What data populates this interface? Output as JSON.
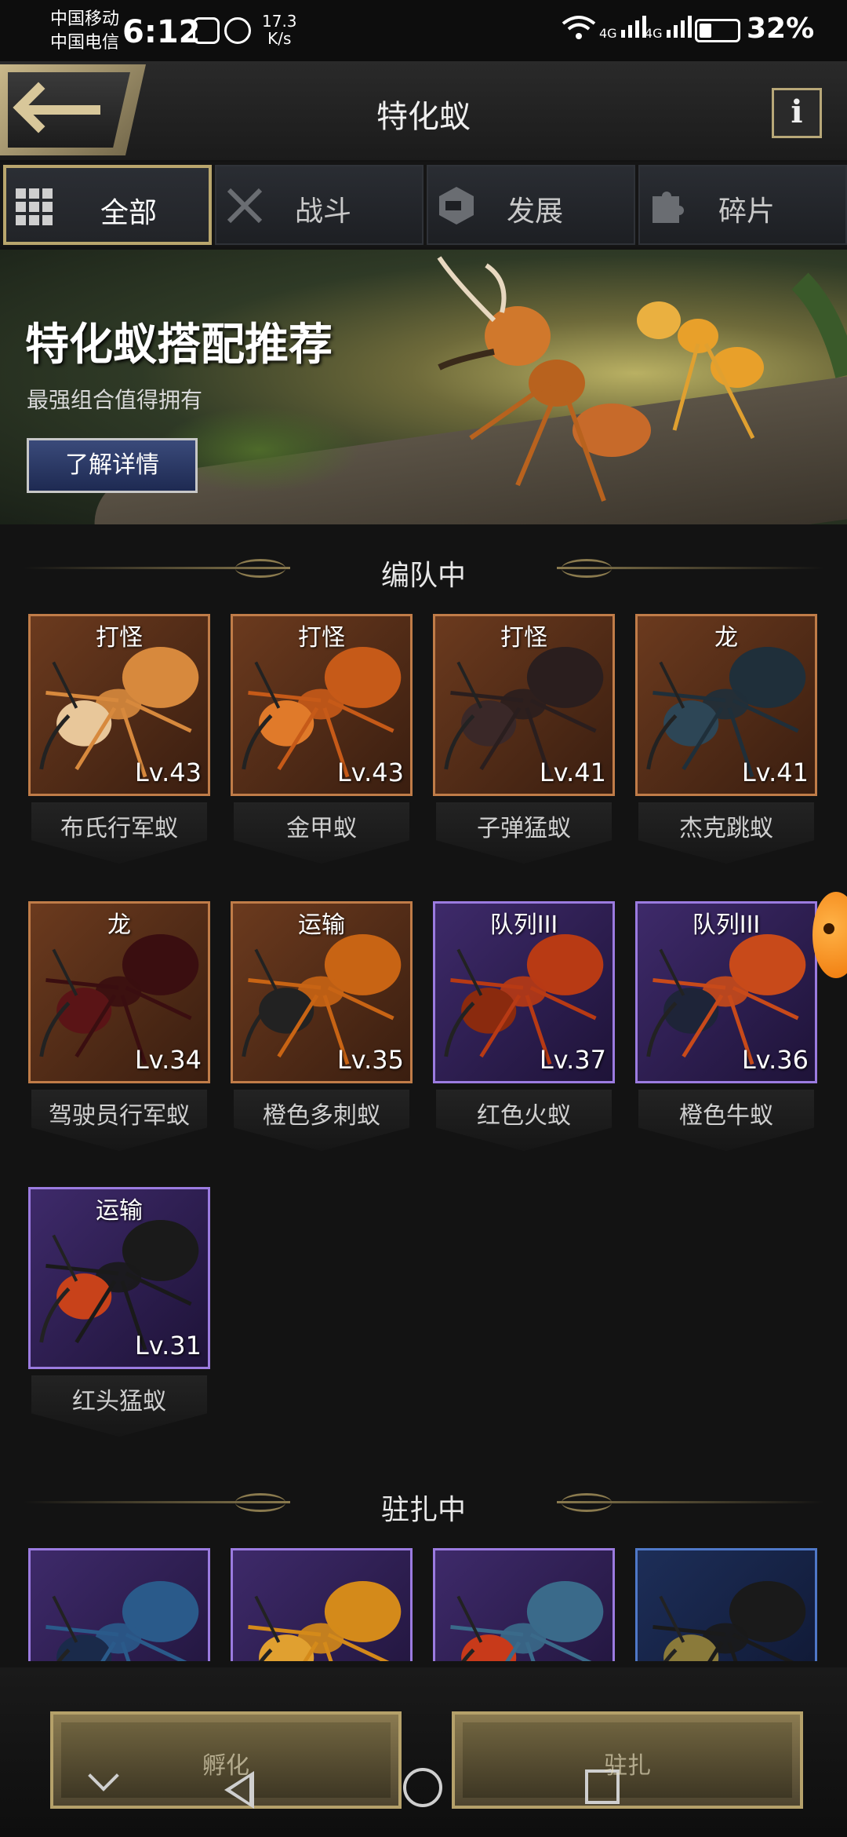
{
  "status_bar": {
    "carrier_1": "中国移动",
    "carrier_2": "中国电信",
    "time": "6:12",
    "net_speed_value": "17.3",
    "net_speed_unit": "K/s",
    "signal_1": "4G",
    "signal_2": "4G",
    "battery": "32%",
    "battery_level": 0.32
  },
  "header": {
    "title": "特化蚁",
    "info_label": "i"
  },
  "tabs": [
    {
      "label": "全部",
      "icon": "grid-icon",
      "active": true
    },
    {
      "label": "战斗",
      "icon": "crossed-swords-icon",
      "active": false
    },
    {
      "label": "发展",
      "icon": "hexagon-icon",
      "active": false
    },
    {
      "label": "碎片",
      "icon": "puzzle-icon",
      "active": false
    }
  ],
  "banner": {
    "title": "特化蚁搭配推荐",
    "subtitle": "最强组合值得拥有",
    "button": "了解详情"
  },
  "sections": {
    "in_team": "编队中",
    "garrisoned": "驻扎中"
  },
  "team_ants": [
    {
      "tag": "打怪",
      "level": "Lv.43",
      "name": "布氏行军蚁",
      "rarity": "orange",
      "body_color": "#d7893d",
      "head_color": "#e8c79a"
    },
    {
      "tag": "打怪",
      "level": "Lv.43",
      "name": "金甲蚁",
      "rarity": "orange",
      "body_color": "#c65a18",
      "head_color": "#e07a2a"
    },
    {
      "tag": "打怪",
      "level": "Lv.41",
      "name": "子弹猛蚁",
      "rarity": "orange",
      "body_color": "#2a1e1e",
      "head_color": "#3a2828"
    },
    {
      "tag": "龙",
      "level": "Lv.41",
      "name": "杰克跳蚁",
      "rarity": "orange",
      "body_color": "#1f2f3a",
      "head_color": "#2d4656"
    },
    {
      "tag": "龙",
      "level": "Lv.34",
      "name": "驾驶员行军蚁",
      "rarity": "orange",
      "body_color": "#3a0e10",
      "head_color": "#5a1416"
    },
    {
      "tag": "运输",
      "level": "Lv.35",
      "name": "橙色多刺蚁",
      "rarity": "orange",
      "body_color": "#c86414",
      "head_color": "#222222"
    },
    {
      "tag": "队列III",
      "level": "Lv.37",
      "name": "红色火蚁",
      "rarity": "purple",
      "body_color": "#b83a14",
      "head_color": "#8a2a0e"
    },
    {
      "tag": "队列III",
      "level": "Lv.36",
      "name": "橙色牛蚁",
      "rarity": "purple",
      "body_color": "#c84a1a",
      "head_color": "#1e2438"
    },
    {
      "tag": "运输",
      "level": "Lv.31",
      "name": "红头猛蚁",
      "rarity": "purple",
      "body_color": "#1a1a1a",
      "head_color": "#c8421a"
    }
  ],
  "garrison_ants": [
    {
      "rarity": "purple",
      "body_color": "#2a5a8a",
      "head_color": "#1a2a4a"
    },
    {
      "rarity": "purple",
      "body_color": "#d48a1a",
      "head_color": "#e0a030"
    },
    {
      "rarity": "purple",
      "body_color": "#3a6a8a",
      "head_color": "#c83a1a"
    },
    {
      "rarity": "blue",
      "body_color": "#1a1a1a",
      "head_color": "#8a7a3a"
    }
  ],
  "bottom": {
    "hatch_label": "孵化",
    "garrison_label": "驻扎"
  },
  "colors": {
    "gold_accent": "#b9a66d",
    "orange_rarity": "#c07c48",
    "purple_rarity": "#9b7be0",
    "blue_rarity": "#4f78c8"
  }
}
